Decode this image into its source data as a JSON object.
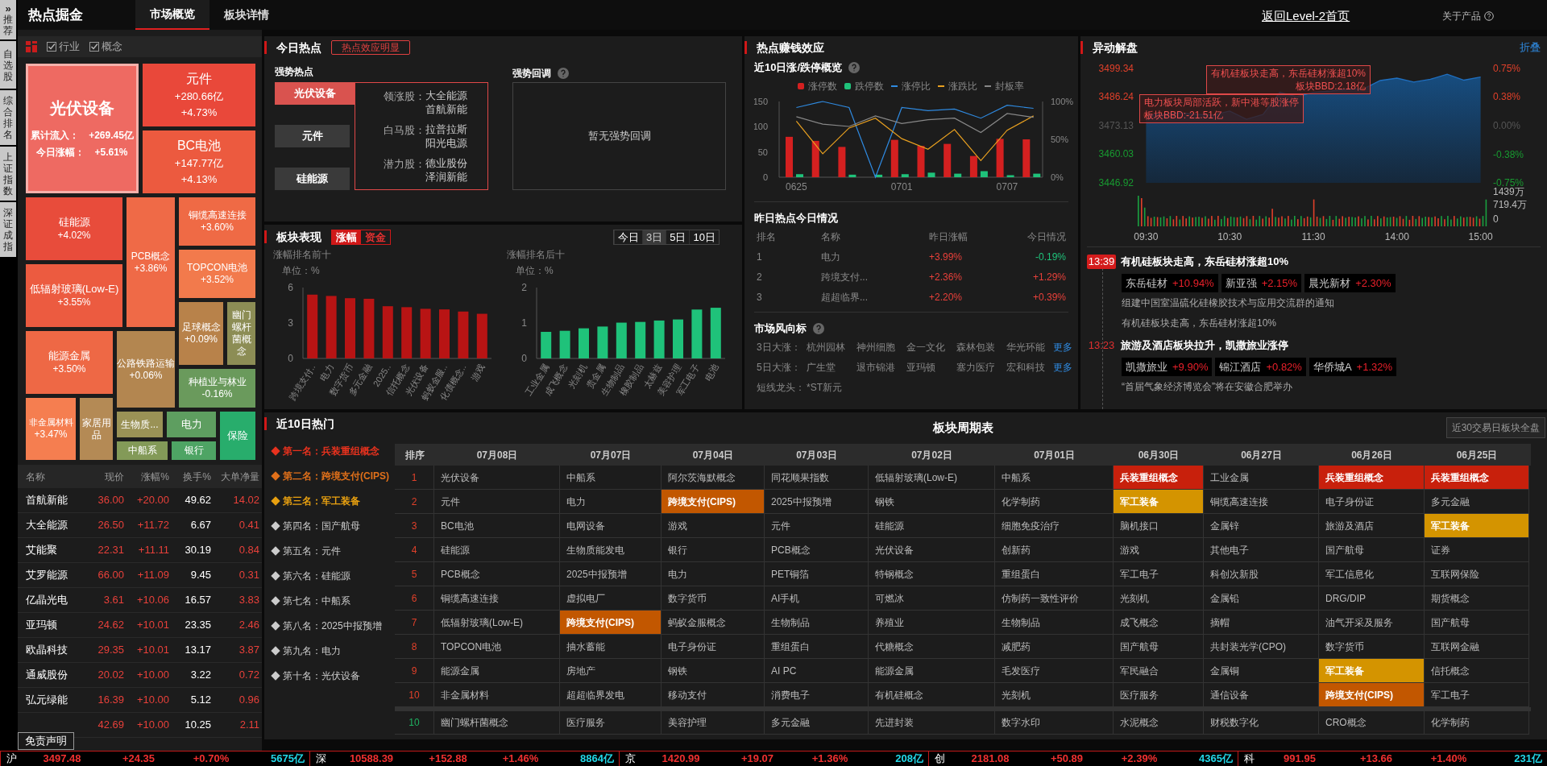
{
  "sidebar": {
    "expand": "»",
    "tabs": [
      {
        "label": "推荐",
        "selected": false
      },
      {
        "label": "自选股",
        "selected": false
      },
      {
        "label": "综合排名",
        "selected": false
      },
      {
        "label": "上证指数",
        "selected": false
      },
      {
        "label": "深证成指",
        "selected": false
      }
    ]
  },
  "header": {
    "title": "热点掘金",
    "tabs": [
      {
        "label": "市场概览",
        "selected": true
      },
      {
        "label": "板块详情",
        "selected": false
      }
    ],
    "home_link": "返回Level-2首页",
    "about": "关于产品"
  },
  "heatmap": {
    "filters": [
      {
        "label": "行业",
        "checked": true
      },
      {
        "label": "概念",
        "checked": true
      }
    ],
    "tiles": [
      {
        "name": "光伏设备",
        "selected": true,
        "color": "#ee6a62",
        "details": [
          {
            "label": "累计流入：",
            "value": "+269.45亿"
          },
          {
            "label": "今日涨幅：",
            "value": "+5.61%"
          }
        ]
      },
      {
        "name": "元件",
        "selected": false,
        "color": "#e9483a",
        "values": [
          "+280.66亿",
          "+4.73%"
        ]
      },
      {
        "name": "BC电池",
        "selected": false,
        "color": "#ec5a3f",
        "values": [
          "+147.77亿",
          "+4.13%"
        ]
      },
      {
        "name": "硅能源",
        "selected": false,
        "color": "#e84c3b",
        "values": [
          "+4.02%"
        ]
      },
      {
        "name": "低辐射玻璃(Low-E)",
        "selected": false,
        "color": "#ec5b40",
        "values": [
          "+3.55%"
        ]
      },
      {
        "name": "PCB概念",
        "selected": false,
        "color": "#ef6a47",
        "values": [
          "+3.86%"
        ]
      },
      {
        "name": "铜缆高速连接",
        "selected": false,
        "color": "#ef6a45",
        "values": [
          "+3.60%"
        ]
      },
      {
        "name": "TOPCON电池",
        "selected": false,
        "color": "#f27a4c",
        "values": [
          "+3.52%"
        ]
      },
      {
        "name": "足球概念",
        "selected": false,
        "color": "#b8824a",
        "values": [
          "+0.09%"
        ]
      },
      {
        "name": "幽门螺杆菌概念",
        "selected": false,
        "color": "#8c8d55"
      },
      {
        "name": "能源金属",
        "selected": false,
        "color": "#ee6845",
        "values": [
          "+3.50%"
        ]
      },
      {
        "name": "公路铁路运输",
        "selected": false,
        "color": "#b38650",
        "values": [
          "+0.06%"
        ]
      },
      {
        "name": "种植业与林业",
        "selected": false,
        "color": "#6a9a5c",
        "values": [
          "-0.16%"
        ]
      },
      {
        "name": "非金属材料",
        "selected": false,
        "color": "#f57e50",
        "values": [
          "+3.47%"
        ]
      },
      {
        "name": "家居用品",
        "selected": false,
        "color": "#b48a55"
      },
      {
        "name": "生物质...",
        "selected": false,
        "color": "#9a9256"
      },
      {
        "name": "电力",
        "selected": false,
        "color": "#5e9e60"
      },
      {
        "name": "保险",
        "selected": false,
        "color": "#28ad6c"
      },
      {
        "name": "中船系",
        "selected": false,
        "color": "#839a58"
      },
      {
        "name": "银行",
        "selected": false,
        "color": "#4ea464"
      }
    ]
  },
  "stock_table": {
    "columns": [
      "名称",
      "现价",
      "涨幅%",
      "换手%",
      "大单净量"
    ],
    "rows": [
      {
        "name": "首航新能",
        "price": "36.00",
        "change": "+20.00",
        "turnover": "49.62",
        "net": "14.02"
      },
      {
        "name": "大全能源",
        "price": "26.50",
        "change": "+11.72",
        "turnover": "6.67",
        "net": "0.41"
      },
      {
        "name": "艾能聚",
        "price": "22.31",
        "change": "+11.11",
        "turnover": "30.19",
        "net": "0.84"
      },
      {
        "name": "艾罗能源",
        "price": "66.00",
        "change": "+11.09",
        "turnover": "9.45",
        "net": "0.31"
      },
      {
        "name": "亿晶光电",
        "price": "3.61",
        "change": "+10.06",
        "turnover": "16.57",
        "net": "3.83"
      },
      {
        "name": "亚玛顿",
        "price": "24.62",
        "change": "+10.01",
        "turnover": "23.35",
        "net": "2.46"
      },
      {
        "name": "欧晶科技",
        "price": "29.35",
        "change": "+10.01",
        "turnover": "13.17",
        "net": "3.87"
      },
      {
        "name": "通威股份",
        "price": "20.02",
        "change": "+10.00",
        "turnover": "3.22",
        "net": "0.72"
      },
      {
        "name": "弘元绿能",
        "price": "16.39",
        "change": "+10.00",
        "turnover": "5.12",
        "net": "0.96"
      },
      {
        "price": "42.69",
        "change": "+10.00",
        "turnover": "10.25",
        "net": "2.11"
      }
    ],
    "disclaimer": "免责声明"
  },
  "today_hot": {
    "title": "今日热点",
    "badge": "热点效应明显",
    "strong_title": "强势热点",
    "sectors": [
      {
        "label": "光伏设备",
        "selected": true
      },
      {
        "label": "元件",
        "selected": false
      },
      {
        "label": "硅能源",
        "selected": false
      }
    ],
    "details": [
      {
        "label": "领涨股：",
        "stocks": [
          "大全能源",
          "首航新能"
        ]
      },
      {
        "label": "白马股：",
        "stocks": [
          "拉普拉斯",
          "阳光电源"
        ]
      },
      {
        "label": "潜力股：",
        "stocks": [
          "德业股份",
          "泽润新能"
        ]
      }
    ],
    "pullback_title": "强势回调",
    "pullback_empty": "暂无强势回调"
  },
  "sector_performance": {
    "title": "板块表现",
    "modes": [
      {
        "label": "涨幅",
        "selected": true
      },
      {
        "label": "资金",
        "selected": false
      }
    ],
    "periods": [
      {
        "label": "今日",
        "selected": false
      },
      {
        "label": "3日",
        "selected": true
      },
      {
        "label": "5日",
        "selected": false
      },
      {
        "label": "10日",
        "selected": false
      }
    ],
    "charts": [
      {
        "chart_data": {
          "type": "bar",
          "title": "涨幅排名前十",
          "ylabel": "单位：%",
          "categories": [
            "跨境支付..",
            "电力",
            "数字货币",
            "多元金融",
            "2025..",
            "信托概念",
            "光伏设备",
            "蚂蚁金服..",
            "化债概念..",
            "游戏"
          ],
          "series": [
            {
              "color": "#b81414",
              "values": [
                5.4,
                5.29,
                5.1,
                5.05,
                4.42,
                4.34,
                4.2,
                4.15,
                3.97,
                3.78
              ]
            }
          ],
          "ylim": [
            0,
            6
          ],
          "yticks": [
            0,
            3,
            6
          ]
        }
      },
      {
        "chart_data": {
          "type": "bar",
          "title": "涨幅排名后十",
          "ylabel": "单位：%",
          "categories": [
            "工业金属",
            "成飞概念",
            "光刻机",
            "贵金属",
            "生物制品",
            "橡胶制品",
            "太赫兹",
            "美容护理",
            "军工电子",
            "电池"
          ],
          "series": [
            {
              "color": "#1fc27a",
              "values": [
                0.75,
                0.78,
                0.85,
                0.9,
                1.01,
                1.03,
                1.07,
                1.1,
                1.38,
                1.43
              ]
            }
          ],
          "ylim": [
            0,
            2
          ],
          "yticks": [
            0,
            1,
            2
          ]
        }
      }
    ]
  },
  "money_effect": {
    "title": "热点赚钱效应",
    "chart_title": "近10日涨/跌停概览",
    "charts": [
      {
        "chart_data": {
          "type": "bar",
          "legend": "top",
          "categories": [
            "0625",
            null,
            null,
            null,
            "0701",
            null,
            null,
            null,
            "0707",
            null
          ],
          "ylim": [
            0,
            150
          ],
          "yticks": [
            0,
            50,
            100,
            150
          ],
          "series": [
            {
              "name": "涨停数",
              "color": "#d42020",
              "values": [
                80,
                72,
                60,
                0,
                74,
                62,
                66,
                42,
                76,
                75
              ]
            },
            {
              "name": "跌停数",
              "color": "#1fc27a",
              "values": [
                6,
                0,
                5,
                5,
                6,
                9,
                7,
                12,
                4,
                7
              ]
            }
          ]
        }
      },
      {
        "chart_data": {
          "type": "line",
          "categories": [
            null,
            null,
            null,
            null,
            null,
            null,
            null,
            null,
            null,
            null
          ],
          "ylim": [
            0,
            100
          ],
          "yticks": [
            {
              "value": 0,
              "label": "0%"
            },
            {
              "value": 50,
              "label": "50%"
            },
            {
              "value": 100,
              "label": "100%"
            }
          ],
          "series": [
            {
              "name": "涨停比",
              "color": "#2f8ae0",
              "values": [
                92,
                100,
                92,
                0,
                92,
                88,
                90,
                78,
                95,
                91
              ]
            },
            {
              "name": "涨跌比",
              "color": "#e8a020",
              "values": [
                74,
                31,
                65,
                78,
                51,
                37,
                63,
                22,
                62,
                81
              ]
            },
            {
              "name": "封板率",
              "color": "#888888",
              "values": [
                80,
                70,
                67,
                81,
                71,
                76,
                78,
                59,
                84,
                79
              ]
            }
          ]
        }
      }
    ],
    "yesterday": {
      "title": "昨日热点今日情况",
      "columns": [
        "排名",
        "名称",
        "昨日涨幅",
        "今日情况"
      ],
      "rows": [
        {
          "rank": "1",
          "name": "电力",
          "yesterday": "+3.99%",
          "today": "-0.19%",
          "today_up": false
        },
        {
          "rank": "2",
          "name": "跨境支付...",
          "yesterday": "+2.36%",
          "today": "+1.29%",
          "today_up": true
        },
        {
          "rank": "3",
          "name": "超超临界...",
          "yesterday": "+2.20%",
          "today": "+0.39%",
          "today_up": true
        }
      ]
    },
    "vane": {
      "title": "市场风向标",
      "rows": [
        {
          "label": "3日大涨：",
          "stocks": [
            "杭州园林",
            "神州细胞",
            "金一文化",
            "森林包装",
            "华光环能"
          ],
          "more": "更多"
        },
        {
          "label": "5日大涨：",
          "stocks": [
            "广生堂",
            "退市锦港",
            "亚玛顿",
            "塞力医疗",
            "宏和科技"
          ],
          "more": "更多"
        },
        {
          "label": "短线龙头：",
          "stocks": [
            "*ST新元"
          ]
        }
      ]
    }
  },
  "movement": {
    "title": "异动解盘",
    "collapse": "折叠",
    "chart_data": {
      "type": "area",
      "categories": [
        "09:30",
        null,
        null,
        null,
        null,
        "10:30",
        null,
        null,
        null,
        null,
        "11:30",
        null,
        null,
        null,
        null,
        "14:00",
        null,
        null,
        null,
        null,
        "15:00"
      ],
      "values": [
        3478.0,
        3478.3,
        3479.0,
        3478.3,
        3478.0,
        3479.8,
        3476.1,
        3478.3,
        3488.4,
        3486.4,
        3488.4,
        3489.0,
        3489.7,
        3490.0,
        3493.8,
        3494.9,
        3493.1,
        3494.4,
        3496.7,
        3494.0,
        3495.4
      ],
      "ylim": [
        3446.92,
        3499.34
      ],
      "yticks": [
        {
          "value": 3499.34,
          "label": "3499.34"
        },
        {
          "value": 3486.24,
          "label": "3486.24"
        },
        {
          "value": 3473.13,
          "label": "3473.13"
        },
        {
          "value": 3460.03,
          "label": "3460.03"
        },
        {
          "value": 3446.92,
          "label": "3446.92"
        }
      ],
      "y2lim": [
        -0.75,
        0.75
      ],
      "y2ticks": [
        {
          "value": 0.75,
          "label": "0.75%"
        },
        {
          "value": 0.38,
          "label": "0.38%"
        },
        {
          "value": 0,
          "label": "0.00%"
        },
        {
          "value": -0.38,
          "label": "-0.38%"
        },
        {
          "value": -0.75,
          "label": "-0.75%"
        }
      ]
    },
    "callouts": [
      {
        "lines": [
          "有机硅板块走高，东岳硅材涨超10%",
          "板块BBD:2.18亿"
        ]
      },
      {
        "lines": [
          "电力板块局部活跃，新中港等股涨停",
          "板块BBD:-21.51亿"
        ]
      }
    ],
    "volume_ticks": [
      "1439万",
      "719.4万",
      "0"
    ],
    "news": [
      {
        "time": "13:39",
        "selected": true,
        "title": "有机硅板块走高，东岳硅材涨超10%",
        "stocks": [
          {
            "name": "东岳硅材",
            "change": "+10.94%"
          },
          {
            "name": "新亚强",
            "change": "+2.15%"
          },
          {
            "name": "晨光新材",
            "change": "+2.30%"
          }
        ],
        "lines": [
          "组建中国室温硫化硅橡胶技术与应用交流群的通知",
          "有机硅板块走高，东岳硅材涨超10%"
        ]
      },
      {
        "time": "13:23",
        "selected": false,
        "title": "旅游及酒店板块拉升，凯撒旅业涨停",
        "stocks": [
          {
            "name": "凯撒旅业",
            "change": "+9.90%"
          },
          {
            "name": "锦江酒店",
            "change": "+0.82%"
          },
          {
            "name": "华侨城A",
            "change": "+1.32%"
          }
        ],
        "lines": [
          "“首届气象经济博览会”将在安徽合肥举办"
        ]
      }
    ]
  },
  "hot10": {
    "title": "近10日热门",
    "items": [
      {
        "label": "第一名：兵装重组概念",
        "color": "#e8321e"
      },
      {
        "label": "第二名：跨境支付(CIPS)",
        "color": "#e0701a"
      },
      {
        "label": "第三名：军工装备",
        "color": "#e8a010"
      },
      {
        "label": "第四名：国产航母",
        "color": "#cccccc"
      },
      {
        "label": "第五名：元件",
        "color": "#cccccc"
      },
      {
        "label": "第六名：硅能源",
        "color": "#cccccc"
      },
      {
        "label": "第七名：中船系",
        "color": "#cccccc"
      },
      {
        "label": "第八名：2025中报预增",
        "color": "#cccccc"
      },
      {
        "label": "第九名：电力",
        "color": "#cccccc"
      },
      {
        "label": "第十名：光伏设备",
        "color": "#cccccc"
      }
    ]
  },
  "cycle_table": {
    "title": "板块周期表",
    "button": "近30交易日板块全盘",
    "columns": [
      "排序",
      "07月08日",
      "07月07日",
      "07月04日",
      "07月03日",
      "07月02日",
      "07月01日",
      "06月30日",
      "06月27日",
      "06月26日",
      "06月25日"
    ],
    "rows": [
      {
        "rank": "1",
        "falling": false,
        "cells": [
          "光伏设备",
          "中船系",
          "阿尔茨海默概念",
          "同花顺果指数",
          "低辐射玻璃(Low-E)",
          "中船系",
          {
            "text": "兵装重组概念",
            "color": "#c8200c"
          },
          "工业金属",
          {
            "text": "兵装重组概念",
            "color": "#c8200c"
          },
          {
            "text": "兵装重组概念",
            "color": "#c8200c"
          }
        ]
      },
      {
        "rank": "2",
        "falling": false,
        "cells": [
          "元件",
          "电力",
          {
            "text": "跨境支付(CIPS)",
            "color": "#c25700"
          },
          "2025中报预增",
          "钢铁",
          "化学制药",
          {
            "text": "军工装备",
            "color": "#d49400"
          },
          "铜缆高速连接",
          "电子身份证",
          "多元金融"
        ]
      },
      {
        "rank": "3",
        "falling": false,
        "cells": [
          "BC电池",
          "电网设备",
          "游戏",
          "元件",
          "硅能源",
          "细胞免疫治疗",
          "脑机接口",
          "金属锌",
          "旅游及酒店",
          {
            "text": "军工装备",
            "color": "#d49400"
          }
        ]
      },
      {
        "rank": "4",
        "falling": false,
        "cells": [
          "硅能源",
          "生物质能发电",
          "银行",
          "PCB概念",
          "光伏设备",
          "创新药",
          "游戏",
          "其他电子",
          "国产航母",
          "证券"
        ]
      },
      {
        "rank": "5",
        "falling": false,
        "cells": [
          "PCB概念",
          "2025中报预增",
          "电力",
          "PET铜箔",
          "特钢概念",
          "重组蛋白",
          "军工电子",
          "科创次新股",
          "军工信息化",
          "互联网保险"
        ]
      },
      {
        "rank": "6",
        "falling": false,
        "cells": [
          "铜缆高速连接",
          "虚拟电厂",
          "数字货币",
          "AI手机",
          "可燃冰",
          "仿制药一致性评价",
          "光刻机",
          "金属铅",
          "DRG/DIP",
          "期货概念"
        ]
      },
      {
        "rank": "7",
        "falling": false,
        "cells": [
          "低辐射玻璃(Low-E)",
          {
            "text": "跨境支付(CIPS)",
            "color": "#c25700"
          },
          "蚂蚁金服概念",
          "生物制品",
          "养殖业",
          "生物制品",
          "成飞概念",
          "摘帽",
          "油气开采及服务",
          "国产航母"
        ]
      },
      {
        "rank": "8",
        "falling": false,
        "cells": [
          "TOPCON电池",
          "抽水蓄能",
          "电子身份证",
          "重组蛋白",
          "代糖概念",
          "减肥药",
          "国产航母",
          "共封装光学(CPO)",
          "数字货币",
          "互联网金融"
        ]
      },
      {
        "rank": "9",
        "falling": false,
        "cells": [
          "能源金属",
          "房地产",
          "钢铁",
          "AI PC",
          "能源金属",
          "毛发医疗",
          "军民融合",
          "金属铜",
          {
            "text": "军工装备",
            "color": "#d49400"
          },
          "信托概念"
        ]
      },
      {
        "rank": "10",
        "falling": false,
        "cells": [
          "非金属材料",
          "超超临界发电",
          "移动支付",
          "消费电子",
          "有机硅概念",
          "光刻机",
          "医疗服务",
          "通信设备",
          {
            "text": "跨境支付(CIPS)",
            "color": "#c25700"
          },
          "军工电子"
        ]
      },
      {
        "rank": "10",
        "falling": true,
        "cells": [
          "幽门螺杆菌概念",
          "医疗服务",
          "美容护理",
          "多元金融",
          "先进封装",
          "数字水印",
          "水泥概念",
          "财税数字化",
          "CRO概念",
          "化学制药"
        ]
      }
    ]
  },
  "indices": [
    {
      "market": "沪",
      "price": "3497.48",
      "change": "+24.35",
      "pct": "+0.70%",
      "amount": "5675亿"
    },
    {
      "market": "深",
      "price": "10588.39",
      "change": "+152.88",
      "pct": "+1.46%",
      "amount": "8864亿"
    },
    {
      "market": "京",
      "price": "1420.99",
      "change": "+19.07",
      "pct": "+1.36%",
      "amount": "208亿"
    },
    {
      "market": "创",
      "price": "2181.08",
      "change": "+50.89",
      "pct": "+2.39%",
      "amount": "4365亿"
    },
    {
      "market": "科",
      "price": "991.95",
      "change": "+13.66",
      "pct": "+1.40%",
      "amount": "231亿"
    }
  ]
}
